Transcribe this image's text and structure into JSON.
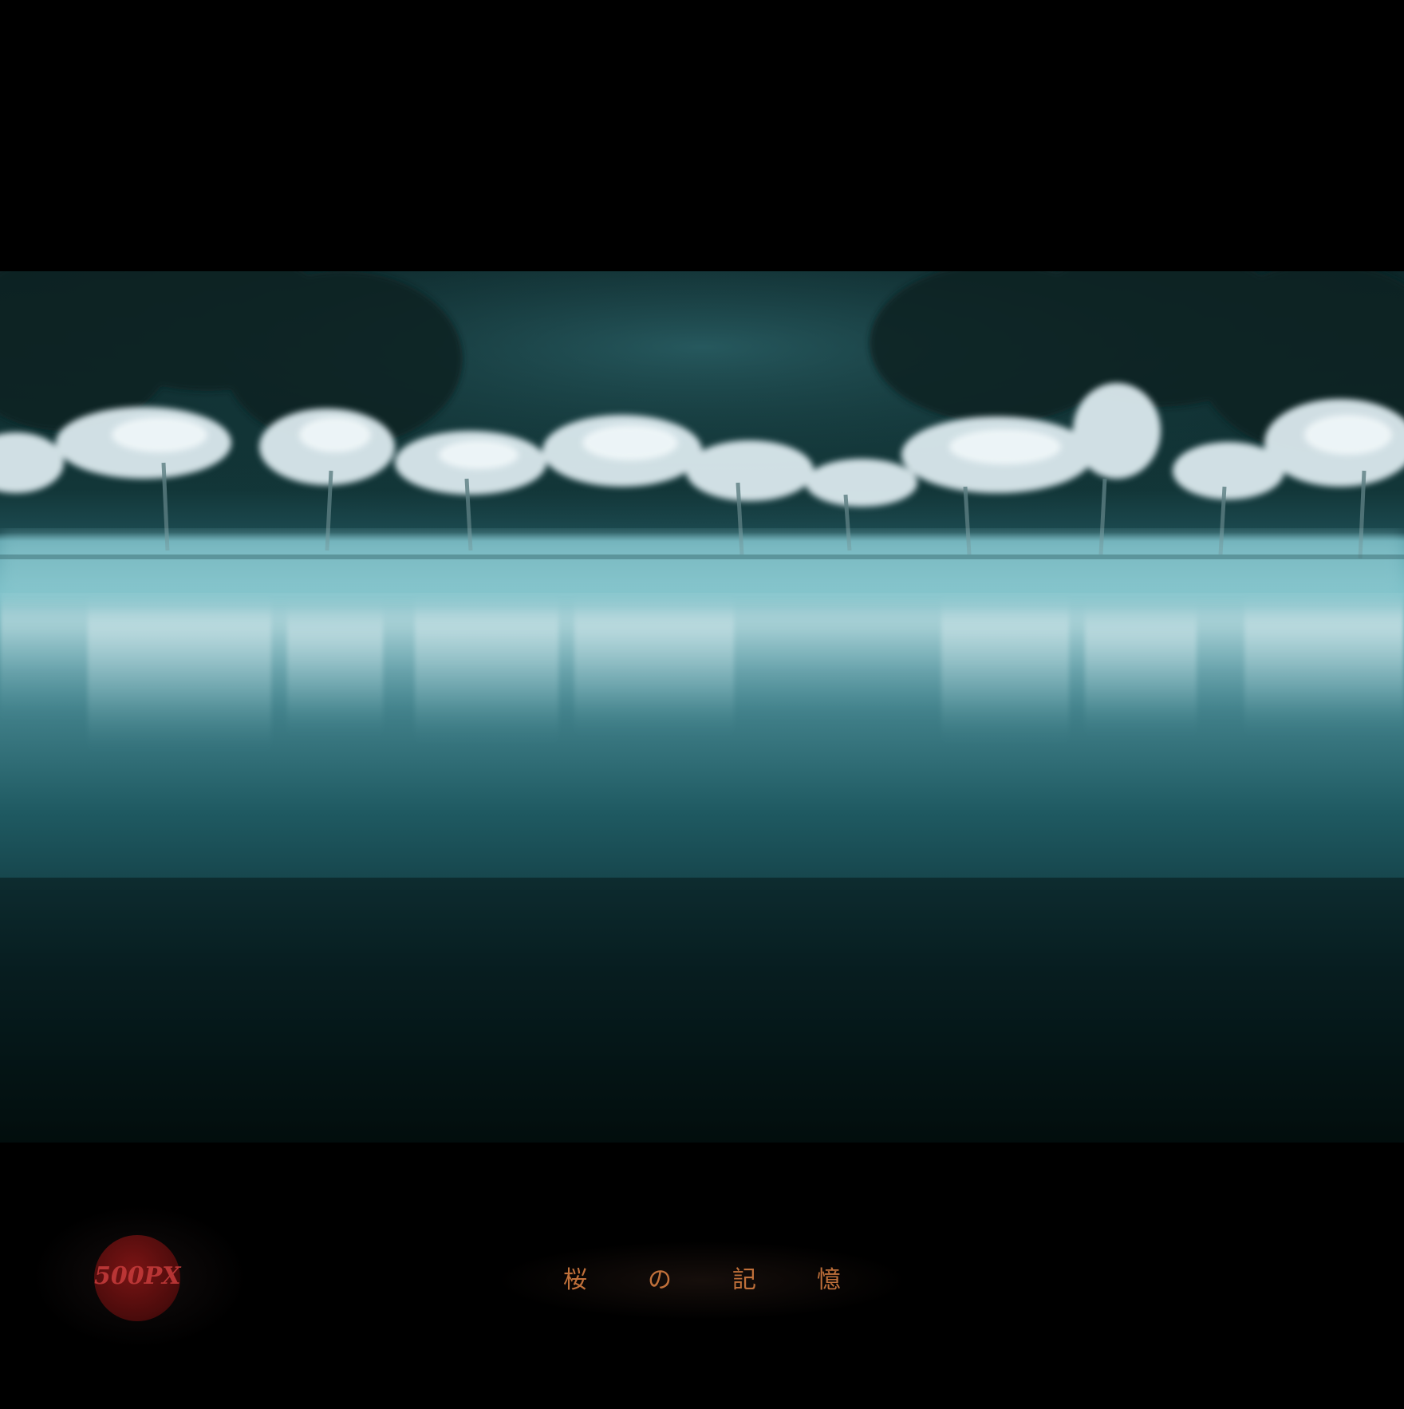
{
  "photo": {
    "subject": "cherry-trees-lake-reflection-photo",
    "palette": {
      "sky_forest": "#0f2f33",
      "mist": "#6fb3bb",
      "water_deep": "#06191c",
      "blossom": "#e8f1f4"
    }
  },
  "caption": {
    "chars": [
      "桜",
      "の",
      "記",
      "憶"
    ],
    "color": "#c0703a"
  },
  "watermark": {
    "text": "500PX",
    "subtext": "",
    "color": "#7a1414"
  }
}
